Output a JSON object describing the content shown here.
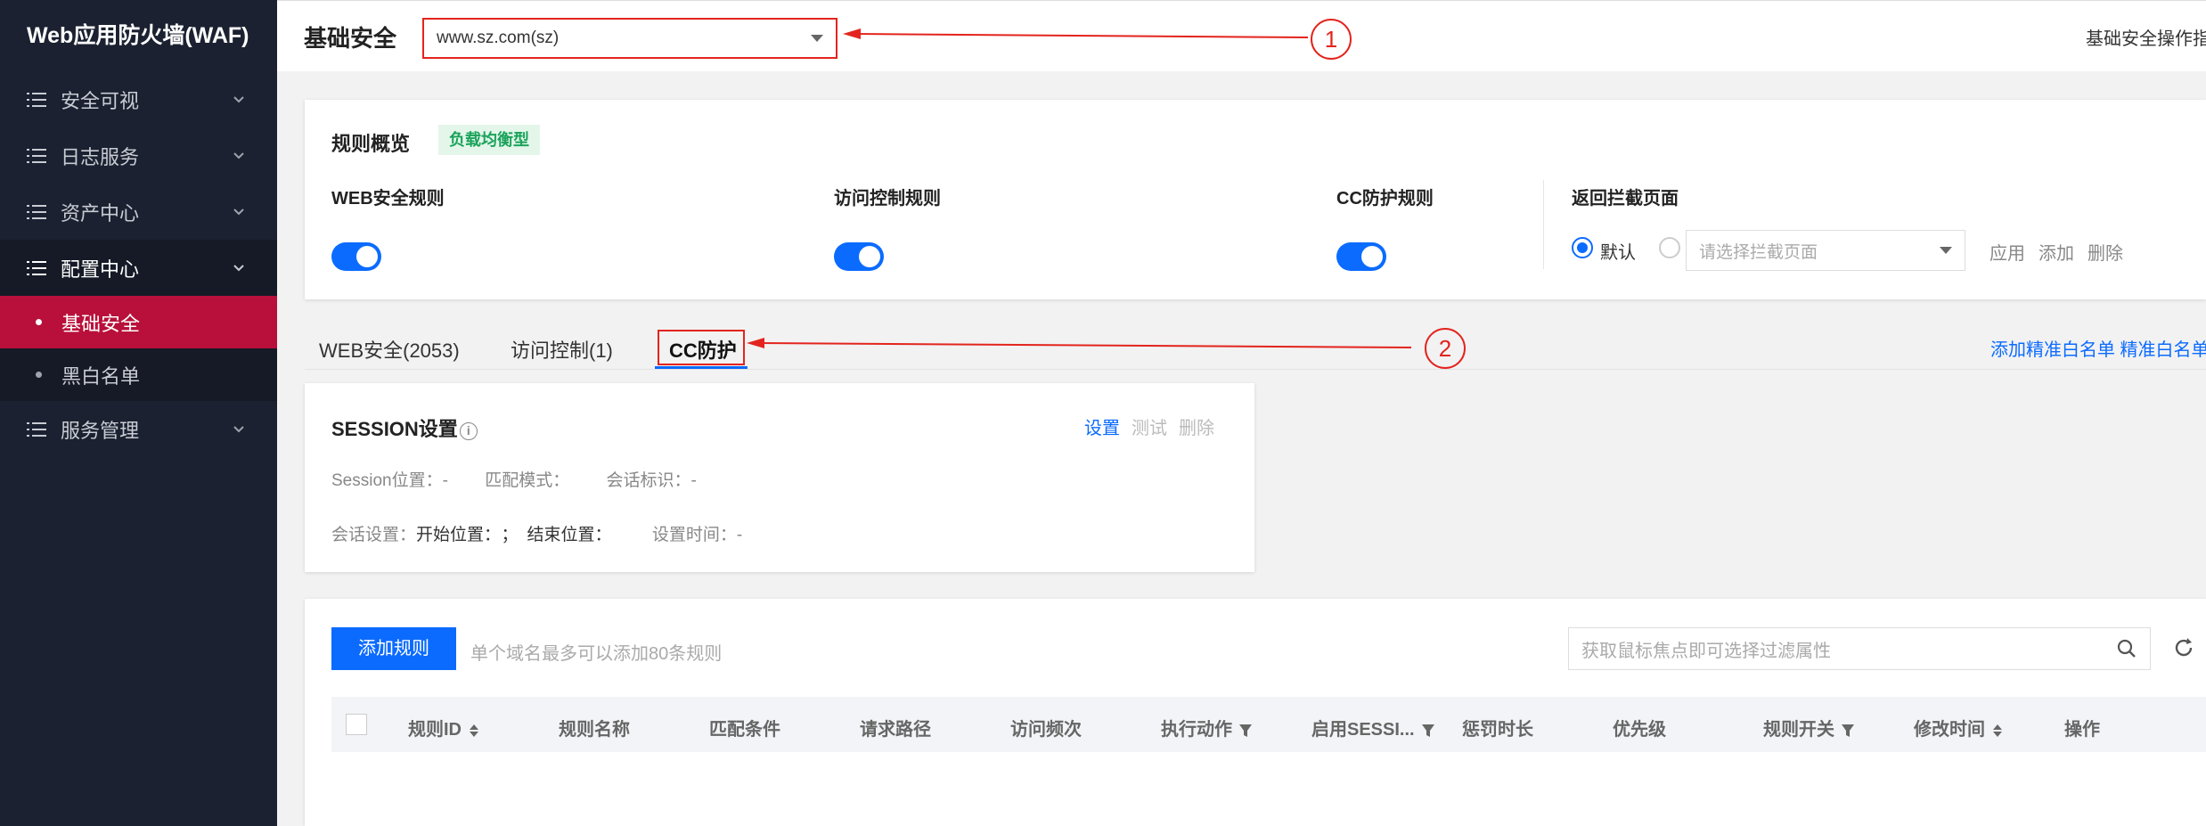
{
  "app": {
    "brand": "Web应用防火墙(WAF)"
  },
  "sidebar": {
    "items": [
      {
        "label": "安全可视"
      },
      {
        "label": "日志服务"
      },
      {
        "label": "资产中心"
      },
      {
        "label": "配置中心"
      },
      {
        "label": "服务管理"
      }
    ],
    "subitems": [
      {
        "label": "基础安全",
        "active": true
      },
      {
        "label": "黑白名单",
        "active": false
      }
    ]
  },
  "header": {
    "title": "基础安全",
    "domain_value": "www.sz.com(sz)",
    "guide_link": "基础安全操作指南"
  },
  "annotations": {
    "one": "1",
    "two": "2"
  },
  "overview": {
    "title": "规则概览",
    "tag": "负载均衡型",
    "web_rule": "WEB安全规则",
    "access_rule": "访问控制规则",
    "cc_rule": "CC防护规则",
    "block_page_title": "返回拦截页面",
    "default_label": "默认",
    "select_placeholder": "请选择拦截页面",
    "apply": "应用",
    "add": "添加",
    "delete": "删除"
  },
  "tabs": [
    {
      "label": "WEB安全(2053)"
    },
    {
      "label": "访问控制(1)"
    },
    {
      "label": "CC防护"
    }
  ],
  "top_links": "添加精准白名单 精准白名单列表",
  "session": {
    "title": "SESSION设置",
    "set": "设置",
    "test": "测试",
    "delete": "删除",
    "row1": {
      "pos_k": "Session位置：",
      "pos_v": "-",
      "match_k": "匹配模式：",
      "id_k": "会话标识：",
      "id_v": "-"
    },
    "row2": {
      "set_k": "会话设置：",
      "start_k": "开始位置：",
      "sep": "；",
      "end_k": "结束位置：",
      "time_k": "设置时间：",
      "time_v": "-"
    }
  },
  "rules": {
    "add_button": "添加规则",
    "hint": "单个域名最多可以添加80条规则",
    "search_placeholder": "获取鼠标焦点即可选择过滤属性",
    "columns": [
      "规则ID",
      "规则名称",
      "匹配条件",
      "请求路径",
      "访问频次",
      "执行动作",
      "启用SESSI...",
      "惩罚时长",
      "优先级",
      "规则开关",
      "修改时间",
      "操作"
    ]
  }
}
